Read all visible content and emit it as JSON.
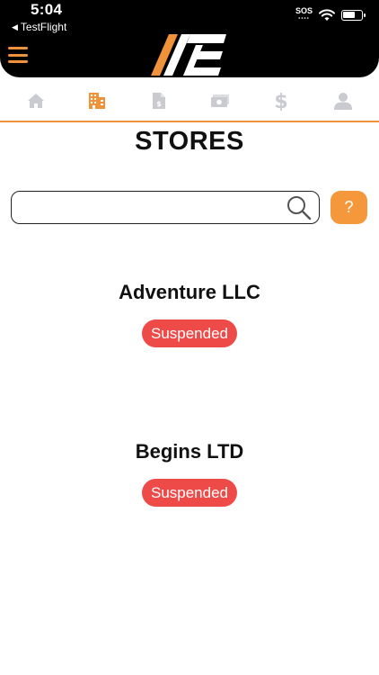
{
  "status_bar": {
    "time": "5:04",
    "back_app": "TestFlight",
    "sos_label": "SOS"
  },
  "header": {
    "menu_icon": "hamburger-icon",
    "logo_icon": "ae-logo"
  },
  "nav": {
    "items": [
      {
        "name": "home",
        "icon": "home-icon",
        "active": false
      },
      {
        "name": "stores",
        "icon": "building-icon",
        "active": true
      },
      {
        "name": "invoices",
        "icon": "invoice-icon",
        "active": false
      },
      {
        "name": "payments",
        "icon": "cash-icon",
        "active": false
      },
      {
        "name": "billing",
        "icon": "dollar-icon",
        "active": false
      },
      {
        "name": "profile",
        "icon": "user-icon",
        "active": false
      }
    ],
    "active_color": "#f0923a",
    "inactive_color": "#c9cbd1"
  },
  "page": {
    "title": "STORES"
  },
  "search": {
    "value": "",
    "placeholder": ""
  },
  "help": {
    "label": "?"
  },
  "stores": [
    {
      "name": "Adventure LLC",
      "status": "Suspended"
    },
    {
      "name": "Begins LTD",
      "status": "Suspended"
    }
  ],
  "colors": {
    "accent": "#f0923a",
    "suspended": "#ee4a48",
    "header_bg": "#000000"
  }
}
